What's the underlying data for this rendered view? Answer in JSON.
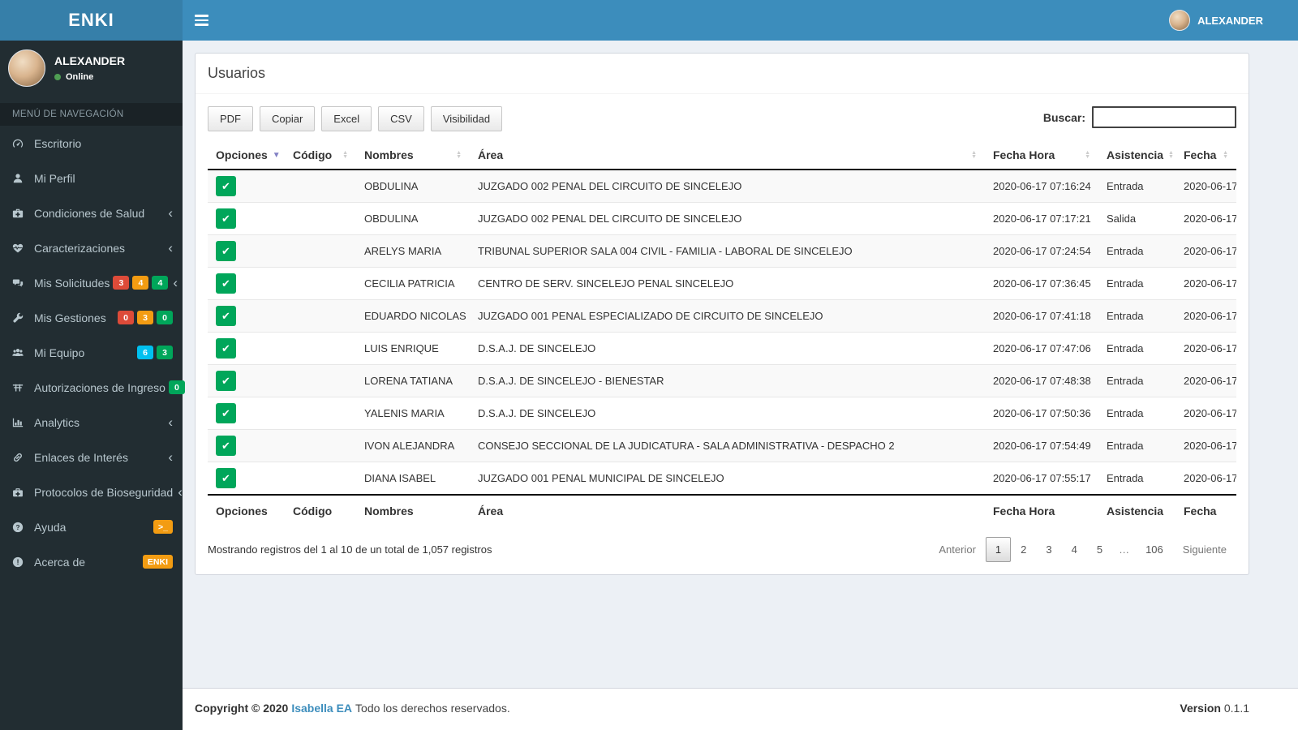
{
  "colors": {
    "navbar": "#3c8dbc",
    "logo_bg": "#367fa9",
    "sidebar_bg": "#222d32",
    "green": "#00a65a",
    "red": "#dd4b39",
    "orange": "#f39c12",
    "lightblue": "#00c0ef",
    "link": "#3c8dbc",
    "content_bg": "#ecf0f5",
    "sort_active": "#8280c4"
  },
  "navbar": {
    "brand": "ENKI",
    "user": "ALEXANDER"
  },
  "sidebar": {
    "user": {
      "name": "ALEXANDER",
      "status": "Online"
    },
    "menu_header": "MENÚ DE NAVEGACIÓN",
    "items": [
      {
        "label": "Escritorio",
        "icon": "gauge-icon"
      },
      {
        "label": "Mi Perfil",
        "icon": "user-icon"
      },
      {
        "label": "Condiciones de Salud",
        "icon": "medkit-icon",
        "chevron": true
      },
      {
        "label": "Caracterizaciones",
        "icon": "heartbeat-icon",
        "chevron": true
      },
      {
        "label": "Mis Solicitudes",
        "icon": "comments-icon",
        "chevron": true,
        "badges": [
          {
            "text": "3",
            "color": "#dd4b39"
          },
          {
            "text": "4",
            "color": "#f39c12"
          },
          {
            "text": "4",
            "color": "#00a65a"
          }
        ]
      },
      {
        "label": "Mis Gestiones",
        "icon": "wrench-icon",
        "badges": [
          {
            "text": "0",
            "color": "#dd4b39"
          },
          {
            "text": "3",
            "color": "#f39c12"
          },
          {
            "text": "0",
            "color": "#00a65a"
          }
        ]
      },
      {
        "label": "Mi Equipo",
        "icon": "users-icon",
        "badges": [
          {
            "text": "6",
            "color": "#00c0ef"
          },
          {
            "text": "3",
            "color": "#00a65a"
          }
        ]
      },
      {
        "label": "Autorizaciones de Ingreso",
        "icon": "text-width-icon",
        "badges": [
          {
            "text": "0",
            "color": "#00a65a"
          }
        ]
      },
      {
        "label": "Analytics",
        "icon": "bar-chart-icon",
        "chevron": true
      },
      {
        "label": "Enlaces de Interés",
        "icon": "link-icon",
        "chevron": true
      },
      {
        "label": "Protocolos de Bioseguridad",
        "icon": "briefcase-medical-icon",
        "chevron": true
      },
      {
        "label": "Ayuda",
        "icon": "question-circle-icon",
        "badges": [
          {
            "text": ">_",
            "color": "#f39c12"
          }
        ]
      },
      {
        "label": "Acerca de",
        "icon": "exclamation-circle-icon",
        "badges": [
          {
            "text": "ENKI",
            "color": "#f39c12"
          }
        ]
      }
    ]
  },
  "main": {
    "title": "Usuarios",
    "toolbar": {
      "buttons": [
        "PDF",
        "Copiar",
        "Excel",
        "CSV",
        "Visibilidad"
      ],
      "search_label": "Buscar:",
      "search_value": ""
    },
    "table": {
      "columns": [
        {
          "label": "Opciones",
          "sort": "desc"
        },
        {
          "label": "Código",
          "sort": "both"
        },
        {
          "label": "Nombres",
          "sort": "both"
        },
        {
          "label": "Área",
          "sort": "both"
        },
        {
          "label": "Fecha Hora",
          "sort": "both"
        },
        {
          "label": "Asistencia",
          "sort": "both"
        },
        {
          "label": "Fecha",
          "sort": "both"
        }
      ],
      "check_glyph": "✔",
      "rows": [
        {
          "codigo": "",
          "nombres": "OBDULINA",
          "area": "JUZGADO 002 PENAL DEL CIRCUITO DE SINCELEJO",
          "fecha_hora": "2020-06-17 07:16:24",
          "asistencia": "Entrada",
          "fecha": "2020-06-17"
        },
        {
          "codigo": "",
          "nombres": "OBDULINA",
          "area": "JUZGADO 002 PENAL DEL CIRCUITO DE SINCELEJO",
          "fecha_hora": "2020-06-17 07:17:21",
          "asistencia": "Salida",
          "fecha": "2020-06-17"
        },
        {
          "codigo": "",
          "nombres": "ARELYS MARIA",
          "area": "TRIBUNAL SUPERIOR SALA 004 CIVIL - FAMILIA - LABORAL DE SINCELEJO",
          "fecha_hora": "2020-06-17 07:24:54",
          "asistencia": "Entrada",
          "fecha": "2020-06-17"
        },
        {
          "codigo": "",
          "nombres": "CECILIA PATRICIA",
          "area": "CENTRO DE SERV. SINCELEJO PENAL SINCELEJO",
          "fecha_hora": "2020-06-17 07:36:45",
          "asistencia": "Entrada",
          "fecha": "2020-06-17"
        },
        {
          "codigo": "",
          "nombres": "EDUARDO NICOLAS",
          "area": "JUZGADO 001 PENAL ESPECIALIZADO DE CIRCUITO DE SINCELEJO",
          "fecha_hora": "2020-06-17 07:41:18",
          "asistencia": "Entrada",
          "fecha": "2020-06-17"
        },
        {
          "codigo": "",
          "nombres": "LUIS ENRIQUE",
          "area": "D.S.A.J. DE SINCELEJO",
          "fecha_hora": "2020-06-17 07:47:06",
          "asistencia": "Entrada",
          "fecha": "2020-06-17"
        },
        {
          "codigo": "",
          "nombres": "LORENA TATIANA",
          "area": "D.S.A.J. DE SINCELEJO - BIENESTAR",
          "fecha_hora": "2020-06-17 07:48:38",
          "asistencia": "Entrada",
          "fecha": "2020-06-17"
        },
        {
          "codigo": "",
          "nombres": "YALENIS MARIA",
          "area": "D.S.A.J. DE SINCELEJO",
          "fecha_hora": "2020-06-17 07:50:36",
          "asistencia": "Entrada",
          "fecha": "2020-06-17"
        },
        {
          "codigo": "",
          "nombres": "IVON ALEJANDRA",
          "area": "CONSEJO SECCIONAL DE LA JUDICATURA - SALA ADMINISTRATIVA - DESPACHO 2",
          "fecha_hora": "2020-06-17 07:54:49",
          "asistencia": "Entrada",
          "fecha": "2020-06-17"
        },
        {
          "codigo": "",
          "nombres": "DIANA ISABEL",
          "area": "JUZGADO 001 PENAL MUNICIPAL DE SINCELEJO",
          "fecha_hora": "2020-06-17 07:55:17",
          "asistencia": "Entrada",
          "fecha": "2020-06-17"
        }
      ]
    },
    "pagination": {
      "info": "Mostrando registros del 1 al 10 de un total de 1,057 registros",
      "prev": "Anterior",
      "pages": [
        "1",
        "2",
        "3",
        "4",
        "5",
        "…",
        "106"
      ],
      "active_page": "1",
      "next": "Siguiente"
    }
  },
  "footer": {
    "copyright_prefix": "Copyright © 2020",
    "brand_link": "Isabella EA",
    "copyright_suffix": "Todo los derechos reservados.",
    "version_label": "Version",
    "version": "0.1.1"
  }
}
